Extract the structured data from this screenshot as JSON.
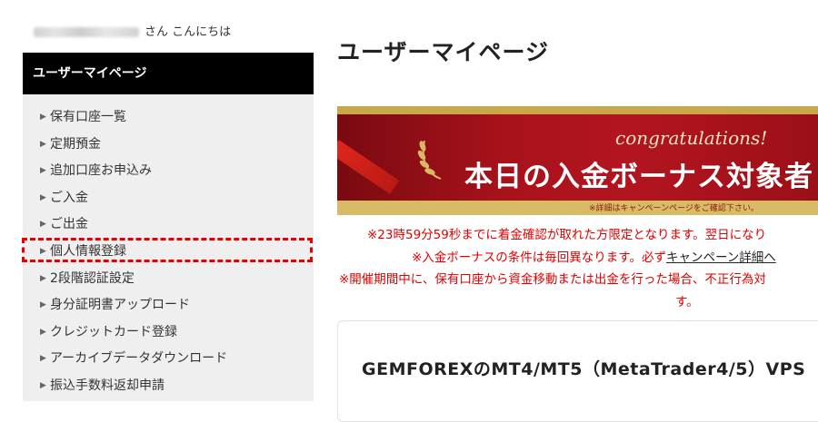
{
  "greeting": {
    "suffix": "さん こんにちは"
  },
  "sidebar": {
    "title": "ユーザーマイページ",
    "items": [
      {
        "label": "保有口座一覧"
      },
      {
        "label": "定期預金"
      },
      {
        "label": "追加口座お申込み"
      },
      {
        "label": "ご入金"
      },
      {
        "label": "ご出金"
      },
      {
        "label": "個人情報登録"
      },
      {
        "label": "2段階認証設定"
      },
      {
        "label": "身分証明書アップロード"
      },
      {
        "label": "クレジットカード登録"
      },
      {
        "label": "アーカイブデータダウンロード"
      },
      {
        "label": "振込手数料返却申請"
      }
    ],
    "highlighted_item": "個人情報登録"
  },
  "main": {
    "title": "ユーザーマイページ",
    "banner": {
      "congrats": "congratulations!",
      "headline": "本日の入金ボーナス対象者",
      "note": "※詳細はキャンペーンページをご確認下さい。"
    },
    "notices": {
      "line1": "※23時59分59秒までに着金確認が取れた方限定となります。翌日になり",
      "line2_pre": "※入金ボーナスの条件は毎回異なります。必ず",
      "line2_link": "キャンペーン詳細へ",
      "line3": "※開催期間中に、保有口座から資金移動または出金を行った場合、不正行為対",
      "line4": "す。"
    },
    "card_title": "GEMFOREXのMT4/MT5（MetaTrader4/5）VPS"
  },
  "colors": {
    "accent_red": "#e00000",
    "sidebar_head": "#000000",
    "banner_red": "#a8121b",
    "banner_gold": "#c9a84a"
  }
}
